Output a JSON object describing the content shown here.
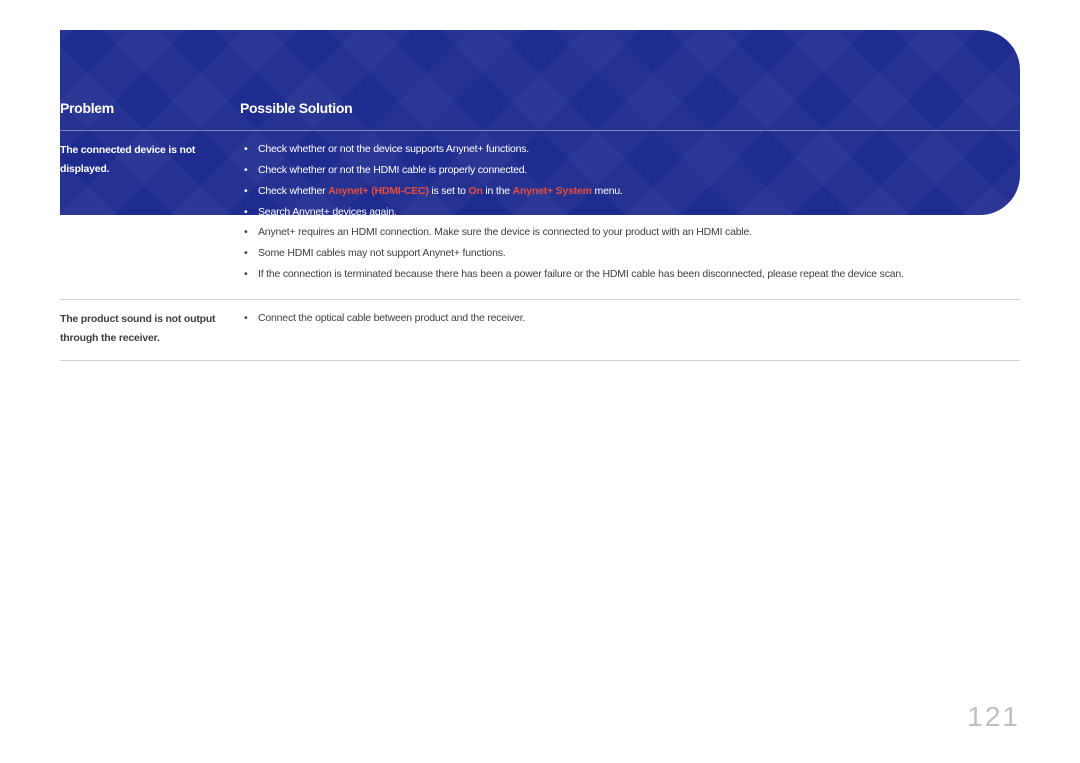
{
  "headers": {
    "problem": "Problem",
    "solution": "Possible Solution"
  },
  "rows": [
    {
      "problem": "The connected device is not displayed.",
      "solutions": [
        {
          "parts": [
            {
              "text": "Check whether or not the device supports Anynet+ functions.",
              "style": "on-dark"
            }
          ]
        },
        {
          "parts": [
            {
              "text": "Check whether or not the HDMI cable is properly connected.",
              "style": "on-dark"
            }
          ]
        },
        {
          "parts": [
            {
              "text": "Check whether ",
              "style": "on-dark"
            },
            {
              "text": "Anynet+ (HDMI-CEC)",
              "style": "highlight-red-bold"
            },
            {
              "text": " is set to ",
              "style": "on-dark"
            },
            {
              "text": "On",
              "style": "highlight-red-bold"
            },
            {
              "text": " in the ",
              "style": "on-dark"
            },
            {
              "text": "Anynet+ System",
              "style": "highlight-red-bold"
            },
            {
              "text": " menu.",
              "style": "on-dark"
            }
          ]
        },
        {
          "parts": [
            {
              "text": "Search Anynet+ devices again.",
              "style": "on-dark"
            }
          ]
        },
        {
          "parts": [
            {
              "text": "Anynet+ requires an HDMI connection. Make sure the device is connected to your product with an HDMI cable.",
              "style": ""
            }
          ]
        },
        {
          "parts": [
            {
              "text": "Some HDMI cables may not support Anynet+ functions.",
              "style": ""
            }
          ]
        },
        {
          "parts": [
            {
              "text": "If the connection is terminated because there has been a power failure or the HDMI cable has been disconnected, please repeat the device scan.",
              "style": ""
            }
          ]
        }
      ]
    },
    {
      "problem": "The product sound is not output through the receiver.",
      "solutions": [
        {
          "parts": [
            {
              "text": "Connect the optical cable between product and the receiver.",
              "style": ""
            }
          ]
        }
      ]
    }
  ],
  "page_number": "121"
}
